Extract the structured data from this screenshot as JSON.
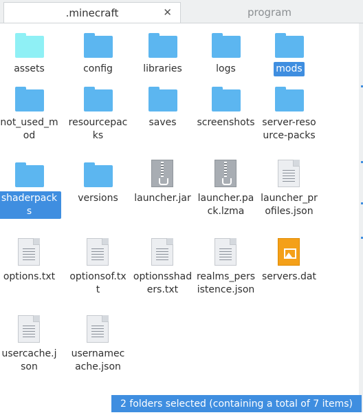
{
  "tabs": [
    {
      "label": ".minecraft",
      "close": "✕"
    },
    {
      "label": "program"
    }
  ],
  "colors": {
    "folder_blue": "#5cb6f0",
    "folder_highlight": "#8ff0f5",
    "selection": "#3f8ee0"
  },
  "items": [
    {
      "name": "assets",
      "type": "folder",
      "highlight": true,
      "selected": false
    },
    {
      "name": "config",
      "type": "folder",
      "selected": false
    },
    {
      "name": "libraries",
      "type": "folder",
      "selected": false
    },
    {
      "name": "logs",
      "type": "folder",
      "selected": false
    },
    {
      "name": "mods",
      "type": "folder",
      "selected": true
    },
    {
      "name": "not_used_mod",
      "type": "folder",
      "selected": false
    },
    {
      "name": "resourcepacks",
      "type": "folder",
      "selected": false
    },
    {
      "name": "saves",
      "type": "folder",
      "selected": false
    },
    {
      "name": "screenshots",
      "type": "folder",
      "selected": false
    },
    {
      "name": "server-resource-packs",
      "type": "folder",
      "selected": false
    },
    {
      "name": "shaderpacks",
      "type": "folder",
      "selected": true
    },
    {
      "name": "versions",
      "type": "folder",
      "selected": false
    },
    {
      "name": "launcher.jar",
      "type": "jar",
      "selected": false
    },
    {
      "name": "launcher.pack.lzma",
      "type": "jar",
      "selected": false
    },
    {
      "name": "launcher_profiles.json",
      "type": "text",
      "selected": false
    },
    {
      "name": "options.txt",
      "type": "text",
      "selected": false
    },
    {
      "name": "optionsof.txt",
      "type": "text",
      "selected": false
    },
    {
      "name": "optionsshaders.txt",
      "type": "text",
      "selected": false
    },
    {
      "name": "realms_persistence.json",
      "type": "text",
      "selected": false
    },
    {
      "name": "servers.dat",
      "type": "image",
      "selected": false
    },
    {
      "name": "usercache.json",
      "type": "text",
      "selected": false
    },
    {
      "name": "usernamecache.json",
      "type": "text",
      "selected": false
    }
  ],
  "status": "2 folders selected (containing a total of 7 items)"
}
